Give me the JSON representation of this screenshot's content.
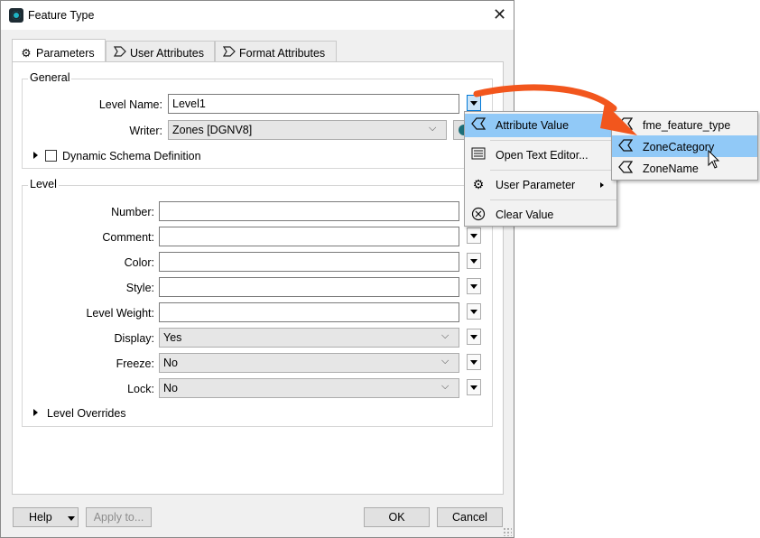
{
  "window": {
    "title": "Feature Type",
    "close_icon": "close-icon"
  },
  "tabs": [
    {
      "label": "Parameters",
      "icon": "gear-icon",
      "active": true
    },
    {
      "label": "User Attributes",
      "icon": "attribute-tag-icon",
      "active": false
    },
    {
      "label": "Format Attributes",
      "icon": "attribute-tag-icon",
      "active": false
    }
  ],
  "general": {
    "group_label": "General",
    "level_name_label": "Level Name:",
    "level_name_value": "Level1",
    "writer_label": "Writer:",
    "writer_value": "Zones [DGNV8]",
    "dynamic_schema_label": "Dynamic Schema Definition",
    "dynamic_schema_checked": false
  },
  "level": {
    "group_label": "Level",
    "fields": [
      {
        "label": "Number:",
        "value": "",
        "type": "text"
      },
      {
        "label": "Comment:",
        "value": "",
        "type": "text"
      },
      {
        "label": "Color:",
        "value": "",
        "type": "text"
      },
      {
        "label": "Style:",
        "value": "",
        "type": "text"
      },
      {
        "label": "Level Weight:",
        "value": "",
        "type": "text"
      },
      {
        "label": "Display:",
        "value": "Yes",
        "type": "select"
      },
      {
        "label": "Freeze:",
        "value": "No",
        "type": "select"
      },
      {
        "label": "Lock:",
        "value": "No",
        "type": "select"
      }
    ],
    "overrides_label": "Level Overrides"
  },
  "footer": {
    "help_label": "Help",
    "apply_label": "Apply to...",
    "ok_label": "OK",
    "cancel_label": "Cancel"
  },
  "context_menu": {
    "items": [
      {
        "label": "Attribute Value",
        "icon": "attribute-tag-icon",
        "highlighted": true,
        "has_submenu": false
      },
      {
        "label": "Open Text Editor...",
        "icon": "text-editor-icon",
        "highlighted": false,
        "has_submenu": false
      },
      {
        "label": "User Parameter",
        "icon": "user-parameter-icon",
        "highlighted": false,
        "has_submenu": true
      },
      {
        "label": "Clear Value",
        "icon": "clear-icon",
        "highlighted": false,
        "has_submenu": false
      }
    ]
  },
  "submenu": {
    "items": [
      {
        "label": "fme_feature_type",
        "highlighted": false
      },
      {
        "label": "ZoneCategory",
        "highlighted": true
      },
      {
        "label": "ZoneName",
        "highlighted": false
      }
    ]
  },
  "colors": {
    "highlight": "#91c9f7",
    "annotation_arrow": "#f2561d",
    "dialog_bg": "#f0f0f0"
  }
}
